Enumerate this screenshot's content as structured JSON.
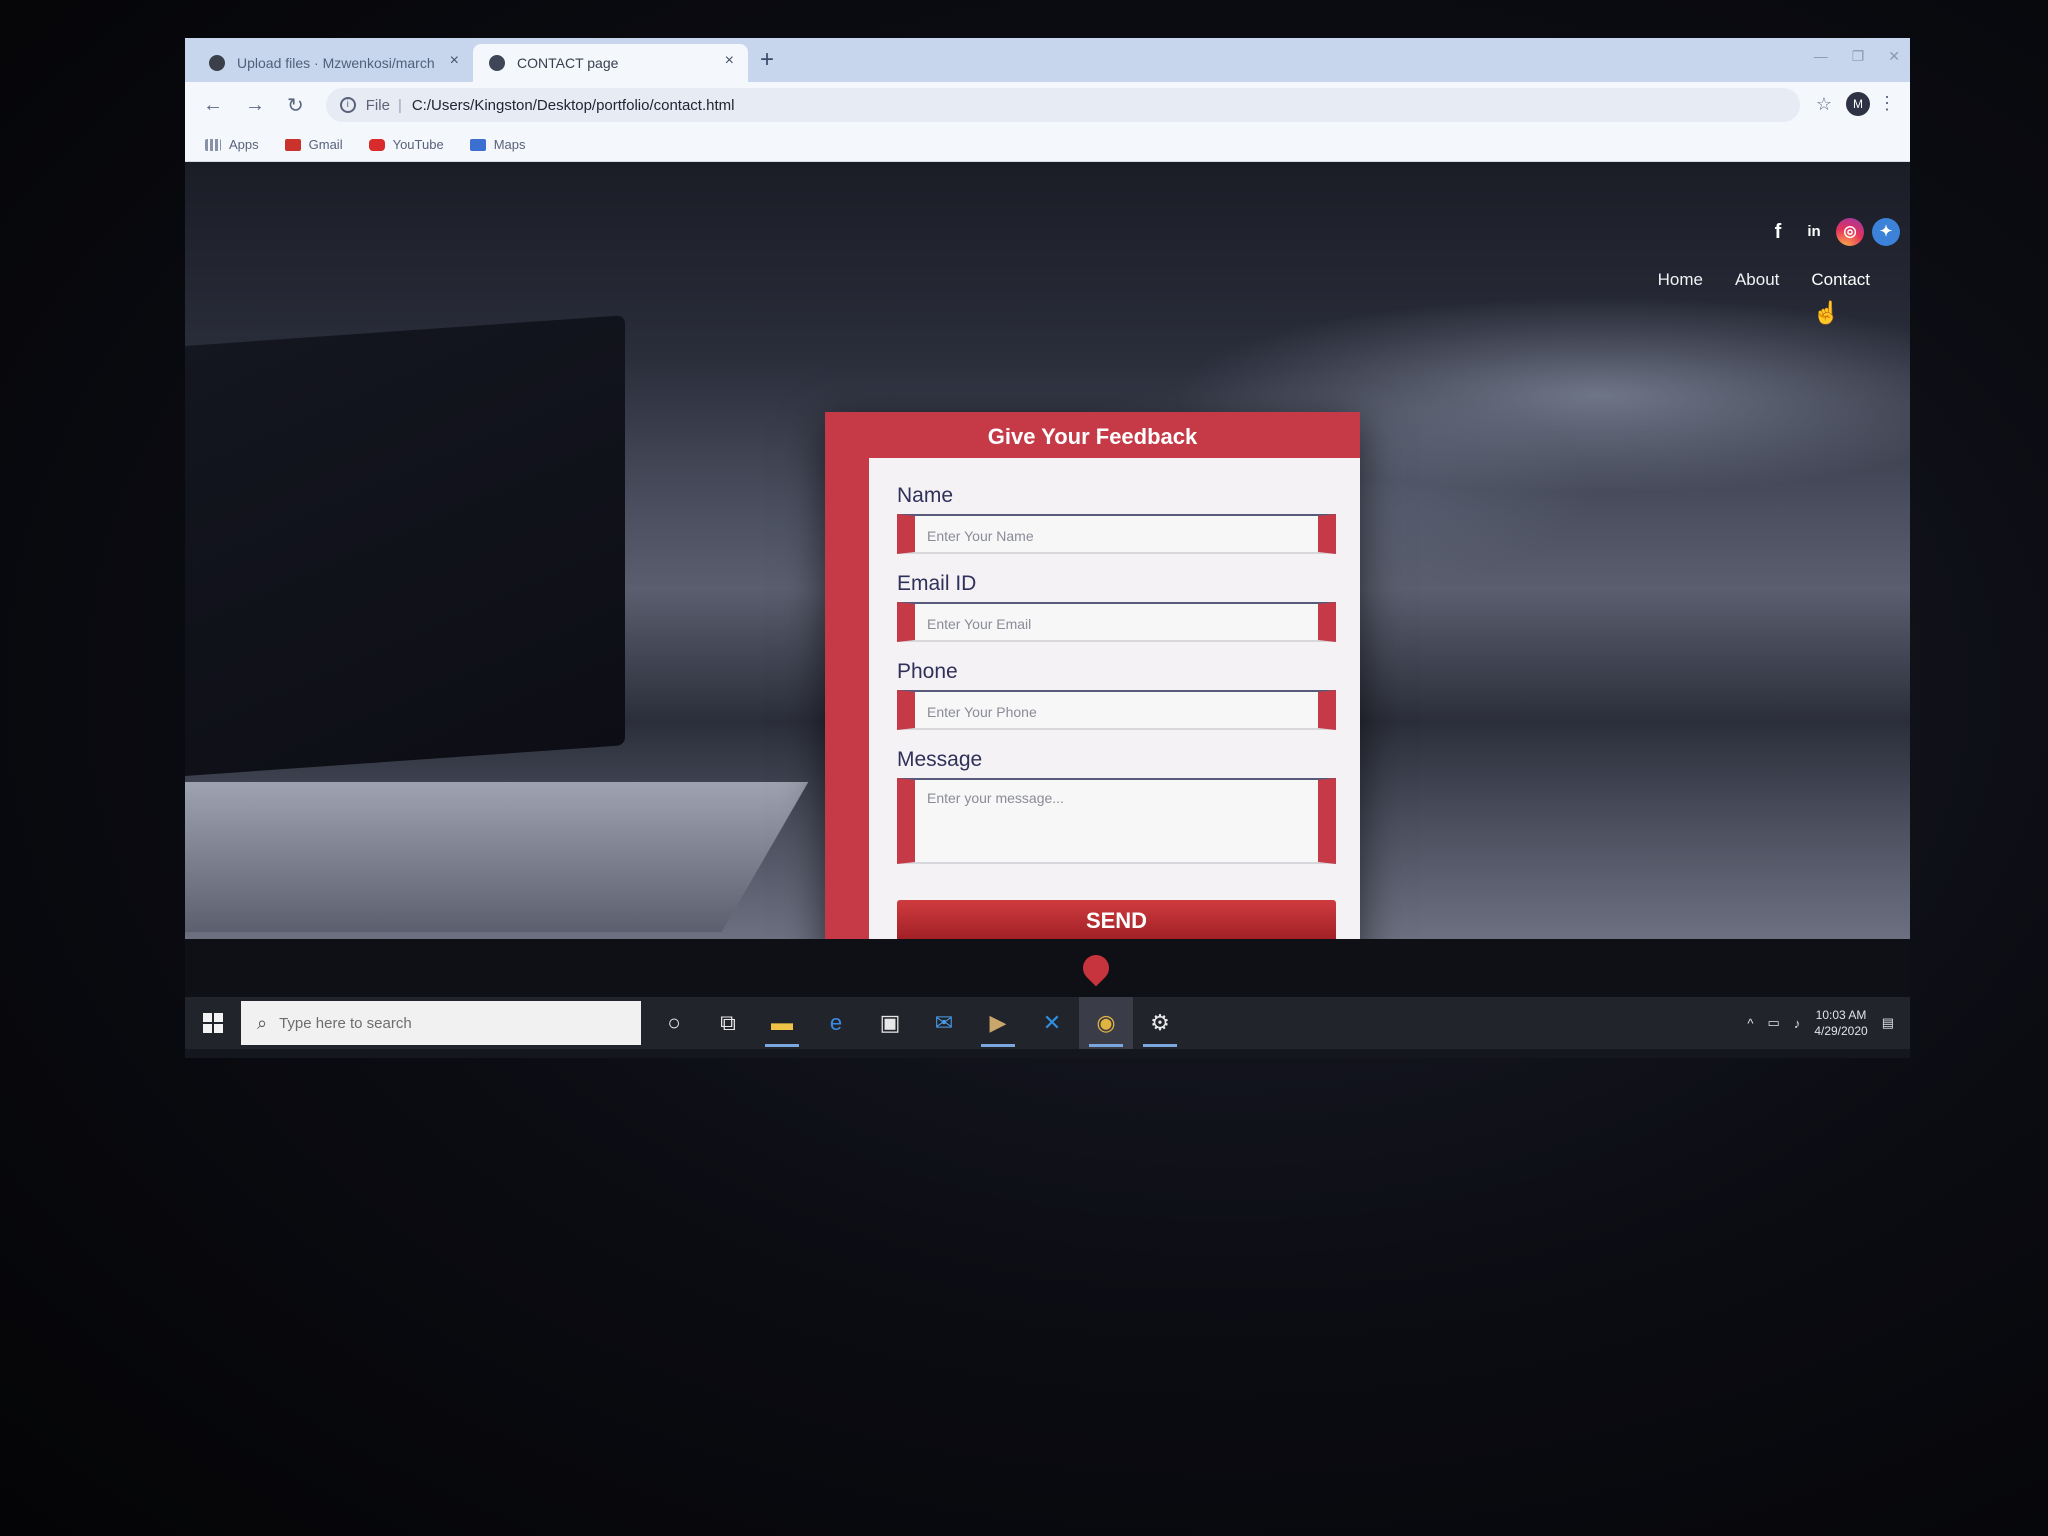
{
  "browser": {
    "tabs": [
      {
        "title": "Upload files · Mzwenkosi/march",
        "active": false
      },
      {
        "title": "CONTACT page",
        "active": true
      }
    ],
    "new_tab": "+",
    "url_label": "File",
    "url": "C:/Users/Kingston/Desktop/portfolio/contact.html",
    "bookmarks": [
      "Apps",
      "Gmail",
      "YouTube",
      "Maps"
    ]
  },
  "site": {
    "socials": [
      "facebook",
      "linkedin",
      "instagram",
      "twitter"
    ],
    "nav": {
      "home": "Home",
      "about": "About",
      "contact": "Contact"
    },
    "form": {
      "title": "Give Your Feedback",
      "name_label": "Name",
      "name_placeholder": "Enter Your Name",
      "email_label": "Email ID",
      "email_placeholder": "Enter Your Email",
      "phone_label": "Phone",
      "phone_placeholder": "Enter Your Phone",
      "message_label": "Message",
      "message_placeholder": "Enter your message...",
      "send": "SEND"
    }
  },
  "taskbar": {
    "search_placeholder": "Type here to search",
    "time": "10:03 AM",
    "date": "4/29/2020"
  },
  "colors": {
    "accent": "#c53a46",
    "label": "#30315a",
    "taskbar": "#22242c"
  }
}
